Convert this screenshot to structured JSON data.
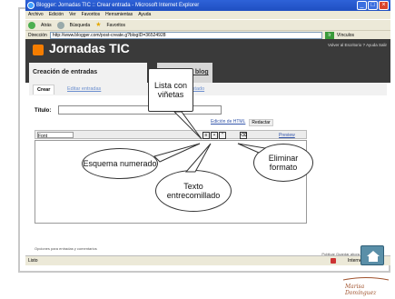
{
  "window": {
    "title": "Blogger: Jornadas TIC :: Crear entrada - Microsoft Internet Explorer"
  },
  "menu": [
    "Archivo",
    "Edición",
    "Ver",
    "Favoritos",
    "Herramientas",
    "Ayuda"
  ],
  "toolbar": {
    "back": "Atrás",
    "search": "Búsqueda",
    "favorites": "Favoritos"
  },
  "address": {
    "label": "Dirección",
    "url": "http://www.blogger.com/post-create.g?blogID=36524928",
    "go": "Ir",
    "links": "Vínculos"
  },
  "blog": {
    "title": "Jornadas TIC",
    "header_links": "Volver al Escritorio   ? Ayuda   Salir"
  },
  "tabs": {
    "creation": "Creación de entradas",
    "layout": "Diseño",
    "view": "Ver blog"
  },
  "subtabs": {
    "create": "Crear",
    "edit": "Editar entradas",
    "status": "Estado"
  },
  "editor": {
    "title_label": "Título:",
    "html_mode": "Edición de HTML",
    "compose_mode": "Redactar",
    "font": "Font",
    "preview": "Preview",
    "status_text": "Opciones para entradas y comentarios",
    "bottom_links": "Publicar   Guardar ahora"
  },
  "status": {
    "left": "Listo",
    "zone": "Internet"
  },
  "callouts": {
    "bulleted_list": "Lista con viñetas",
    "numbered_outline": "Esquema numerado",
    "quoted_text": "Texto entrecomillado",
    "remove_format": "Eliminar formato"
  },
  "signature": "Marisa Domínguez"
}
